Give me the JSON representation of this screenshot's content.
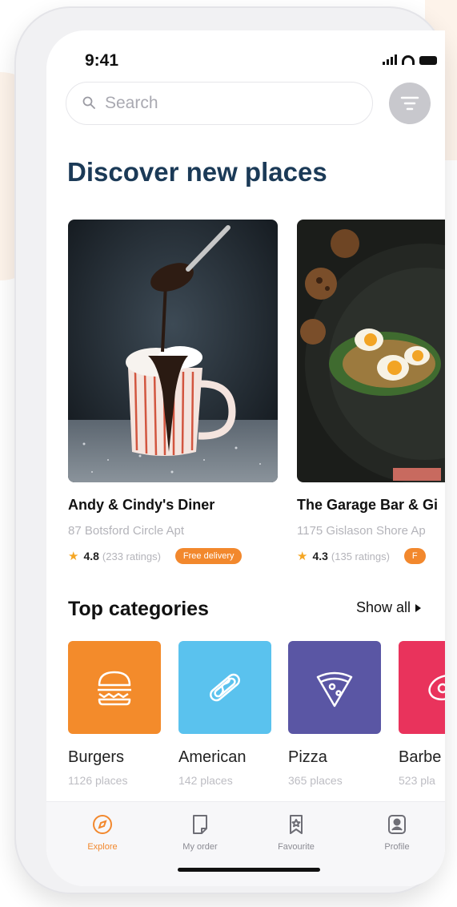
{
  "status": {
    "time": "9:41"
  },
  "search": {
    "placeholder": "Search"
  },
  "heading": "Discover new places",
  "places": [
    {
      "name": "Andy & Cindy's Diner",
      "address": "87 Botsford Circle Apt",
      "rating": "4.8",
      "ratings_count": "(233 ratings)",
      "badge": "Free delivery"
    },
    {
      "name": "The Garage Bar & Gi",
      "address": "1175 Gislason Shore Ap",
      "rating": "4.3",
      "ratings_count": "(135 ratings)",
      "badge": "F"
    }
  ],
  "categories_section": {
    "title": "Top categories",
    "show_all": "Show all"
  },
  "categories": [
    {
      "name": "Burgers",
      "count": "1126 places",
      "color": "#f38b2b",
      "icon": "burger-icon"
    },
    {
      "name": "American",
      "count": "142 places",
      "color": "#5ac2ee",
      "icon": "hotdog-icon"
    },
    {
      "name": "Pizza",
      "count": "365 places",
      "color": "#5a56a4",
      "icon": "pizza-icon"
    },
    {
      "name": "Barbe",
      "count": "523 pla",
      "color": "#e9335c",
      "icon": "meat-icon"
    }
  ],
  "tabbar": {
    "explore": "Explore",
    "my_order": "My order",
    "favourite": "Favourite",
    "profile": "Profile"
  },
  "colors": {
    "accent": "#f2882d",
    "heading": "#1b3a57"
  }
}
